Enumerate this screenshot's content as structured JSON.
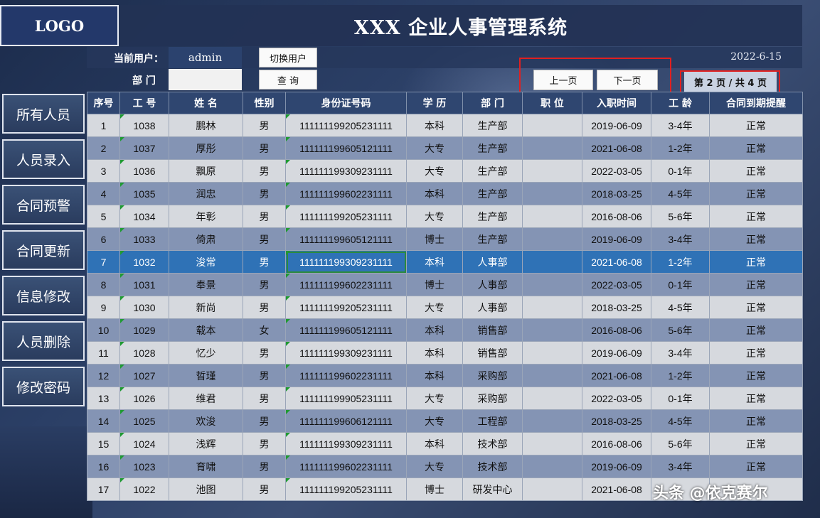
{
  "header": {
    "logo": "LOGO",
    "title": "XXX 企业人事管理系统"
  },
  "info": {
    "current_user_label": "当前用户：",
    "current_user": "admin",
    "switch_user": "切换用户",
    "date": "2022-6-15",
    "dept_label": "部 门",
    "dept_value": "",
    "query": "查 询",
    "prev_page": "上一页",
    "next_page": "下一页",
    "page_status": "第 2 页 / 共 4 页"
  },
  "sidebar": {
    "items": [
      {
        "label": "所有人员"
      },
      {
        "label": "人员录入"
      },
      {
        "label": "合同预警"
      },
      {
        "label": "合同更新"
      },
      {
        "label": "信息修改"
      },
      {
        "label": "人员删除"
      },
      {
        "label": "修改密码"
      }
    ]
  },
  "table": {
    "headers": [
      "序号",
      "工 号",
      "姓 名",
      "性别",
      "身份证号码",
      "学 历",
      "部 门",
      "职 位",
      "入职时间",
      "工 龄",
      "合同到期提醒"
    ],
    "selected_row": 7,
    "rows": [
      [
        "1",
        "1038",
        "鹏林",
        "男",
        "111111199205231111",
        "本科",
        "生产部",
        "",
        "2019-06-09",
        "3-4年",
        "正常"
      ],
      [
        "2",
        "1037",
        "厚彤",
        "男",
        "111111199605121111",
        "大专",
        "生产部",
        "",
        "2021-06-08",
        "1-2年",
        "正常"
      ],
      [
        "3",
        "1036",
        "飘原",
        "男",
        "111111199309231111",
        "大专",
        "生产部",
        "",
        "2022-03-05",
        "0-1年",
        "正常"
      ],
      [
        "4",
        "1035",
        "润忠",
        "男",
        "111111199602231111",
        "本科",
        "生产部",
        "",
        "2018-03-25",
        "4-5年",
        "正常"
      ],
      [
        "5",
        "1034",
        "年彰",
        "男",
        "111111199205231111",
        "大专",
        "生产部",
        "",
        "2016-08-06",
        "5-6年",
        "正常"
      ],
      [
        "6",
        "1033",
        "倚肃",
        "男",
        "111111199605121111",
        "博士",
        "生产部",
        "",
        "2019-06-09",
        "3-4年",
        "正常"
      ],
      [
        "7",
        "1032",
        "浚常",
        "男",
        "111111199309231111",
        "本科",
        "人事部",
        "",
        "2021-06-08",
        "1-2年",
        "正常"
      ],
      [
        "8",
        "1031",
        "奉景",
        "男",
        "111111199602231111",
        "博士",
        "人事部",
        "",
        "2022-03-05",
        "0-1年",
        "正常"
      ],
      [
        "9",
        "1030",
        "新尚",
        "男",
        "111111199205231111",
        "大专",
        "人事部",
        "",
        "2018-03-25",
        "4-5年",
        "正常"
      ],
      [
        "10",
        "1029",
        "载本",
        "女",
        "111111199605121111",
        "本科",
        "销售部",
        "",
        "2016-08-06",
        "5-6年",
        "正常"
      ],
      [
        "11",
        "1028",
        "忆少",
        "男",
        "111111199309231111",
        "本科",
        "销售部",
        "",
        "2019-06-09",
        "3-4年",
        "正常"
      ],
      [
        "12",
        "1027",
        "晢瑾",
        "男",
        "111111199602231111",
        "本科",
        "采购部",
        "",
        "2021-06-08",
        "1-2年",
        "正常"
      ],
      [
        "13",
        "1026",
        "维君",
        "男",
        "111111199905231111",
        "大专",
        "采购部",
        "",
        "2022-03-05",
        "0-1年",
        "正常"
      ],
      [
        "14",
        "1025",
        "欢浚",
        "男",
        "111111199606121111",
        "大专",
        "工程部",
        "",
        "2018-03-25",
        "4-5年",
        "正常"
      ],
      [
        "15",
        "1024",
        "浅辉",
        "男",
        "111111199309231111",
        "本科",
        "技术部",
        "",
        "2016-08-06",
        "5-6年",
        "正常"
      ],
      [
        "16",
        "1023",
        "育啸",
        "男",
        "111111199602231111",
        "大专",
        "技术部",
        "",
        "2019-06-09",
        "3-4年",
        "正常"
      ],
      [
        "17",
        "1022",
        "池图",
        "男",
        "111111199205231111",
        "博士",
        "研发中心",
        "",
        "2021-06-08",
        "",
        ""
      ]
    ]
  },
  "watermark": "头条 @依克赛尔"
}
